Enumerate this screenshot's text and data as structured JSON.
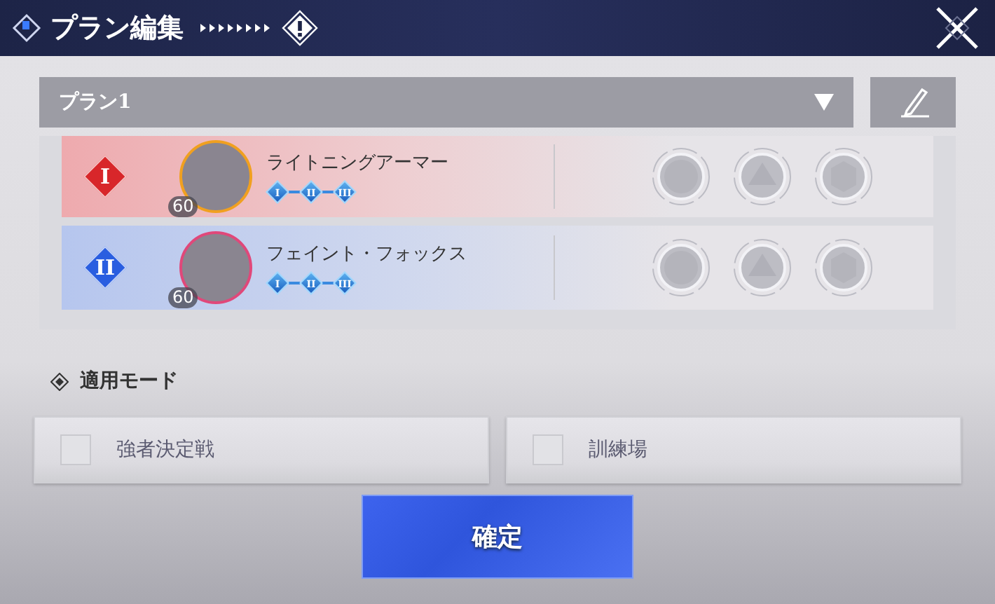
{
  "window": {
    "title": "プラン編集"
  },
  "plan_select": {
    "value": "プラン1"
  },
  "members": [
    {
      "rank": {
        "label": "I",
        "color": "#d8262a"
      },
      "avatar": {
        "color": "#f0a020"
      },
      "level": "60",
      "name": "ライトニングアーマー",
      "skills": [
        "I",
        "II",
        "III"
      ],
      "kind": "red"
    },
    {
      "rank": {
        "label": "II",
        "color": "#2a5ee0"
      },
      "avatar": {
        "color": "#e0487a"
      },
      "level": "60",
      "name": "フェイント・フォックス",
      "skills": [
        "I",
        "II",
        "III"
      ],
      "kind": "blue"
    }
  ],
  "mode_section": {
    "title": "適用モード"
  },
  "modes": [
    {
      "label": "強者決定戦",
      "checked": false
    },
    {
      "label": "訓練場",
      "checked": false
    }
  ],
  "confirm_button": {
    "label": "確定"
  }
}
